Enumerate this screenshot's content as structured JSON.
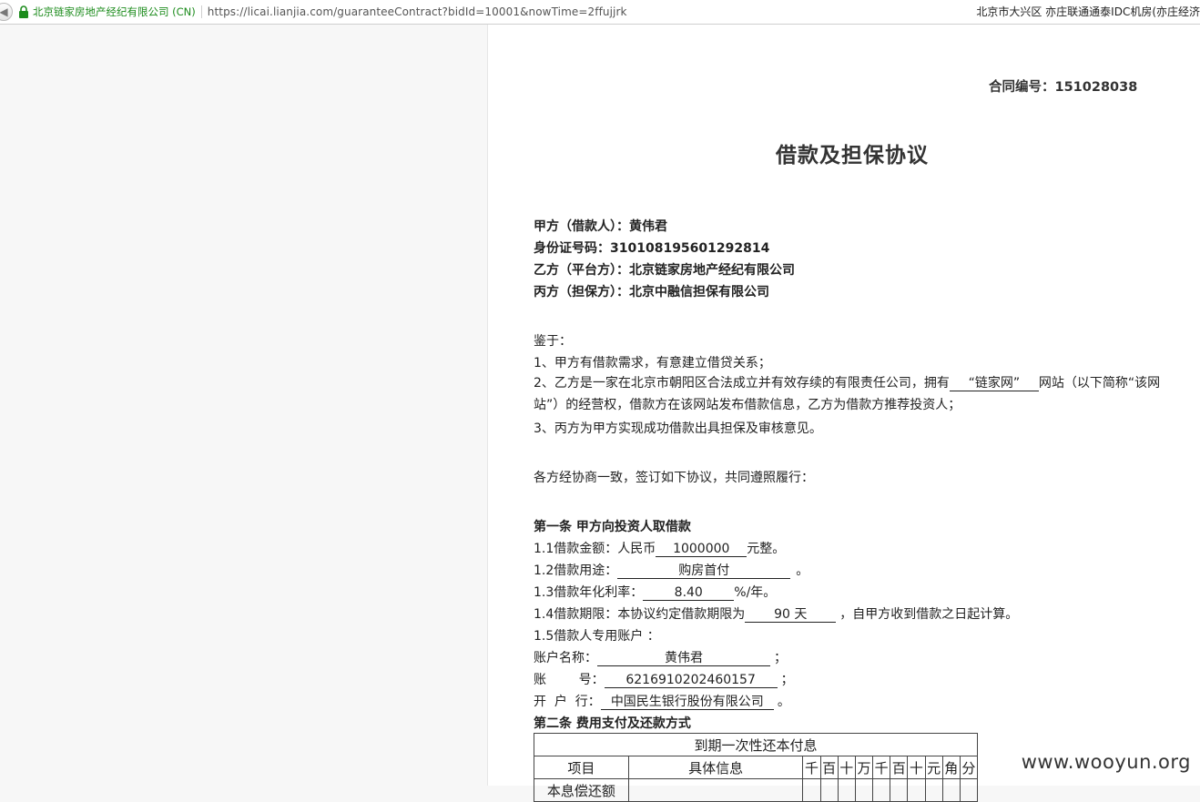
{
  "browser": {
    "cert_name": "北京链家房地产经纪有限公司 (CN)",
    "url": "https://licai.lianjia.com/guaranteeContract?bidId=10001&nowTime=2ffujjrk",
    "location_text": "北京市大兴区 亦庄联通通泰IDC机房(亦庄经济",
    "accent_green": "#1d8c1d"
  },
  "contract": {
    "number_label": "合同编号：151028038",
    "title": "借款及担保协议",
    "party_a": "甲方（借款人）：黄伟君",
    "id_number": "身份证号码：310108195601292814",
    "party_b": "乙方（平台方）：北京链家房地产经纪有限公司",
    "party_c": "丙方（担保方）：北京中融信担保有限公司",
    "whereas": "鉴于：",
    "recital_1": "1、甲方有借款需求，有意建立借贷关系；",
    "recital_2_pre": "2、乙方是一家在北京市朝阳区合法成立并有效存续的有限责任公司，拥有",
    "recital_2_site": "“链家网”",
    "recital_2_post": "网站（以下简称“该网站”）的经营权，借款方在该网站发布借款信息，乙方为借款方推荐投资人；",
    "recital_3": "3、丙方为甲方实现成功借款出具担保及审核意见。",
    "agreement": "各方经协商一致，签订如下协议，共同遵照履行：",
    "article1_title": "第一条 甲方向投资人取借款",
    "amount_label": "1.1借款金额：人民币",
    "amount_value": "1000000",
    "amount_suffix": "元整。",
    "purpose_label": "1.2借款用途：",
    "purpose_value": "购房首付",
    "purpose_suffix": "。",
    "rate_label": "1.3借款年化利率：",
    "rate_value": "8.40",
    "rate_suffix": "%/年。",
    "term_label": "1.4借款期限：本协议约定借款期限为",
    "term_value": "90 天",
    "term_suffix": "，自甲方收到借款之日起计算。",
    "account_heading": "1.5借款人专用账户 ：",
    "account_name_label": "账户名称：",
    "account_name_value": "黄伟君",
    "account_number_label": "账        号：",
    "account_number_value": "6216910202460157",
    "bank_label": "开  户  行：",
    "bank_value": "中国民生银行股份有限公司",
    "semicolon": "；",
    "period": "。",
    "article2_title": "第二条 费用支付及还款方式",
    "table_caption": "到期一次性还本付息",
    "col_item": "项目",
    "col_info": "具体信息",
    "digit_cols": [
      "千",
      "百",
      "十",
      "万",
      "千",
      "百",
      "十",
      "元",
      "角",
      "分"
    ],
    "row1_label": "本息偿还额"
  },
  "watermark": "www.wooyun.org"
}
